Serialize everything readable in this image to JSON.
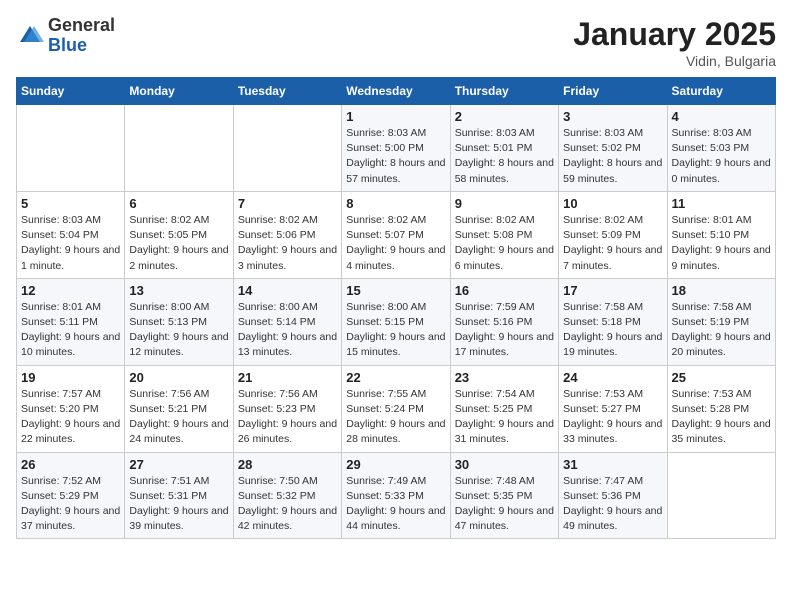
{
  "header": {
    "logo_general": "General",
    "logo_blue": "Blue",
    "month": "January 2025",
    "location": "Vidin, Bulgaria"
  },
  "weekdays": [
    "Sunday",
    "Monday",
    "Tuesday",
    "Wednesday",
    "Thursday",
    "Friday",
    "Saturday"
  ],
  "weeks": [
    [
      {
        "day": "",
        "info": ""
      },
      {
        "day": "",
        "info": ""
      },
      {
        "day": "",
        "info": ""
      },
      {
        "day": "1",
        "info": "Sunrise: 8:03 AM\nSunset: 5:00 PM\nDaylight: 8 hours and 57 minutes."
      },
      {
        "day": "2",
        "info": "Sunrise: 8:03 AM\nSunset: 5:01 PM\nDaylight: 8 hours and 58 minutes."
      },
      {
        "day": "3",
        "info": "Sunrise: 8:03 AM\nSunset: 5:02 PM\nDaylight: 8 hours and 59 minutes."
      },
      {
        "day": "4",
        "info": "Sunrise: 8:03 AM\nSunset: 5:03 PM\nDaylight: 9 hours and 0 minutes."
      }
    ],
    [
      {
        "day": "5",
        "info": "Sunrise: 8:03 AM\nSunset: 5:04 PM\nDaylight: 9 hours and 1 minute."
      },
      {
        "day": "6",
        "info": "Sunrise: 8:02 AM\nSunset: 5:05 PM\nDaylight: 9 hours and 2 minutes."
      },
      {
        "day": "7",
        "info": "Sunrise: 8:02 AM\nSunset: 5:06 PM\nDaylight: 9 hours and 3 minutes."
      },
      {
        "day": "8",
        "info": "Sunrise: 8:02 AM\nSunset: 5:07 PM\nDaylight: 9 hours and 4 minutes."
      },
      {
        "day": "9",
        "info": "Sunrise: 8:02 AM\nSunset: 5:08 PM\nDaylight: 9 hours and 6 minutes."
      },
      {
        "day": "10",
        "info": "Sunrise: 8:02 AM\nSunset: 5:09 PM\nDaylight: 9 hours and 7 minutes."
      },
      {
        "day": "11",
        "info": "Sunrise: 8:01 AM\nSunset: 5:10 PM\nDaylight: 9 hours and 9 minutes."
      }
    ],
    [
      {
        "day": "12",
        "info": "Sunrise: 8:01 AM\nSunset: 5:11 PM\nDaylight: 9 hours and 10 minutes."
      },
      {
        "day": "13",
        "info": "Sunrise: 8:00 AM\nSunset: 5:13 PM\nDaylight: 9 hours and 12 minutes."
      },
      {
        "day": "14",
        "info": "Sunrise: 8:00 AM\nSunset: 5:14 PM\nDaylight: 9 hours and 13 minutes."
      },
      {
        "day": "15",
        "info": "Sunrise: 8:00 AM\nSunset: 5:15 PM\nDaylight: 9 hours and 15 minutes."
      },
      {
        "day": "16",
        "info": "Sunrise: 7:59 AM\nSunset: 5:16 PM\nDaylight: 9 hours and 17 minutes."
      },
      {
        "day": "17",
        "info": "Sunrise: 7:58 AM\nSunset: 5:18 PM\nDaylight: 9 hours and 19 minutes."
      },
      {
        "day": "18",
        "info": "Sunrise: 7:58 AM\nSunset: 5:19 PM\nDaylight: 9 hours and 20 minutes."
      }
    ],
    [
      {
        "day": "19",
        "info": "Sunrise: 7:57 AM\nSunset: 5:20 PM\nDaylight: 9 hours and 22 minutes."
      },
      {
        "day": "20",
        "info": "Sunrise: 7:56 AM\nSunset: 5:21 PM\nDaylight: 9 hours and 24 minutes."
      },
      {
        "day": "21",
        "info": "Sunrise: 7:56 AM\nSunset: 5:23 PM\nDaylight: 9 hours and 26 minutes."
      },
      {
        "day": "22",
        "info": "Sunrise: 7:55 AM\nSunset: 5:24 PM\nDaylight: 9 hours and 28 minutes."
      },
      {
        "day": "23",
        "info": "Sunrise: 7:54 AM\nSunset: 5:25 PM\nDaylight: 9 hours and 31 minutes."
      },
      {
        "day": "24",
        "info": "Sunrise: 7:53 AM\nSunset: 5:27 PM\nDaylight: 9 hours and 33 minutes."
      },
      {
        "day": "25",
        "info": "Sunrise: 7:53 AM\nSunset: 5:28 PM\nDaylight: 9 hours and 35 minutes."
      }
    ],
    [
      {
        "day": "26",
        "info": "Sunrise: 7:52 AM\nSunset: 5:29 PM\nDaylight: 9 hours and 37 minutes."
      },
      {
        "day": "27",
        "info": "Sunrise: 7:51 AM\nSunset: 5:31 PM\nDaylight: 9 hours and 39 minutes."
      },
      {
        "day": "28",
        "info": "Sunrise: 7:50 AM\nSunset: 5:32 PM\nDaylight: 9 hours and 42 minutes."
      },
      {
        "day": "29",
        "info": "Sunrise: 7:49 AM\nSunset: 5:33 PM\nDaylight: 9 hours and 44 minutes."
      },
      {
        "day": "30",
        "info": "Sunrise: 7:48 AM\nSunset: 5:35 PM\nDaylight: 9 hours and 47 minutes."
      },
      {
        "day": "31",
        "info": "Sunrise: 7:47 AM\nSunset: 5:36 PM\nDaylight: 9 hours and 49 minutes."
      },
      {
        "day": "",
        "info": ""
      }
    ]
  ]
}
